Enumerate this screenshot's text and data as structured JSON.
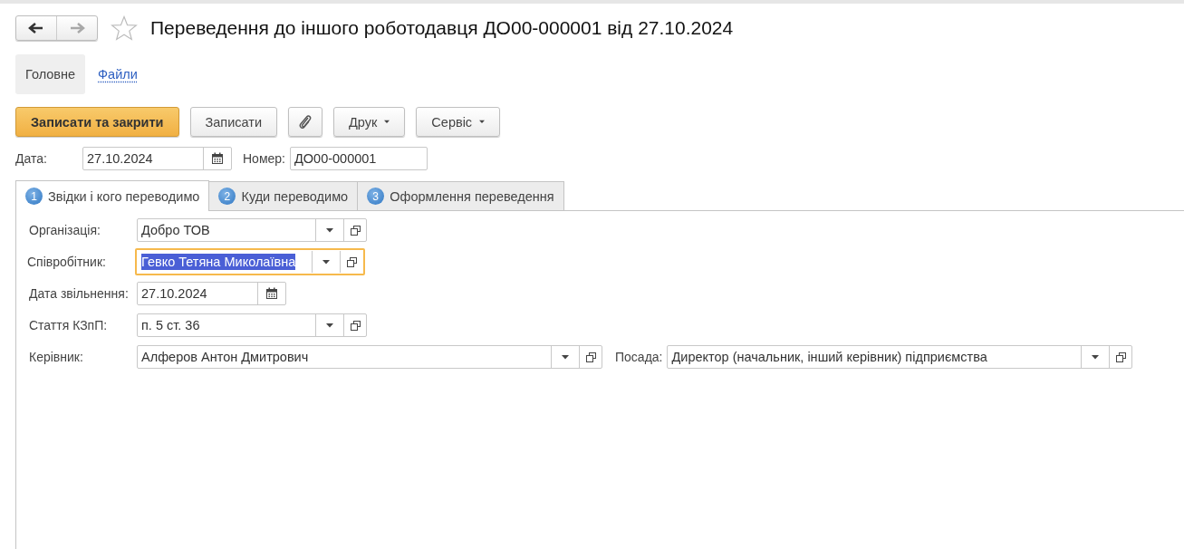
{
  "nav": {
    "back_enabled": true,
    "forward_enabled": false
  },
  "favorite": false,
  "title": "Переведення до іншого роботодавця ДО00-000001 від 27.10.2024",
  "sections": [
    {
      "label": "Головне",
      "selected": true
    },
    {
      "label": "Файли",
      "selected": false
    }
  ],
  "toolbar": [
    {
      "kind": "primary",
      "label": "Записати та закрити"
    },
    {
      "kind": "plain",
      "label": "Записати"
    },
    {
      "kind": "attach"
    },
    {
      "kind": "menu",
      "label": "Друк"
    },
    {
      "kind": "menu",
      "label": "Сервіс"
    }
  ],
  "header_fields": [
    {
      "label": "Дата:",
      "kind": "date",
      "value": "27.10.2024",
      "focused": false
    },
    {
      "label": "Номер:",
      "kind": "text",
      "value": "ДО00-000001",
      "focused": false
    }
  ],
  "tabs": [
    {
      "number": "1",
      "label": "Звідки і кого переводимо",
      "selected": true
    },
    {
      "number": "2",
      "label": "Куди переводимо",
      "selected": false
    },
    {
      "number": "3",
      "label": "Оформлення переведення",
      "selected": false
    }
  ],
  "rows": [
    [
      {
        "label": "Організація:",
        "kind": "select",
        "value": "Добро ТОВ",
        "focused": false
      }
    ],
    [
      {
        "label": "Співробітник:",
        "kind": "select",
        "value": "Гевко Тетяна Миколаївна",
        "focused": true
      }
    ],
    [
      {
        "label": "Дата звільнення:",
        "kind": "date",
        "value": "27.10.2024",
        "focused": false
      }
    ],
    [
      {
        "label": "Стаття КЗпП:",
        "kind": "select",
        "value": "п. 5 ст. 36",
        "focused": false
      }
    ],
    [
      {
        "label": "Керівник:",
        "kind": "select",
        "value": "Алферов Антон Дмитрович",
        "focused": false
      },
      {
        "label": "Посада:",
        "kind": "select",
        "value": "Директор (начальник, інший керівник) підприємства",
        "focused": false
      }
    ]
  ]
}
